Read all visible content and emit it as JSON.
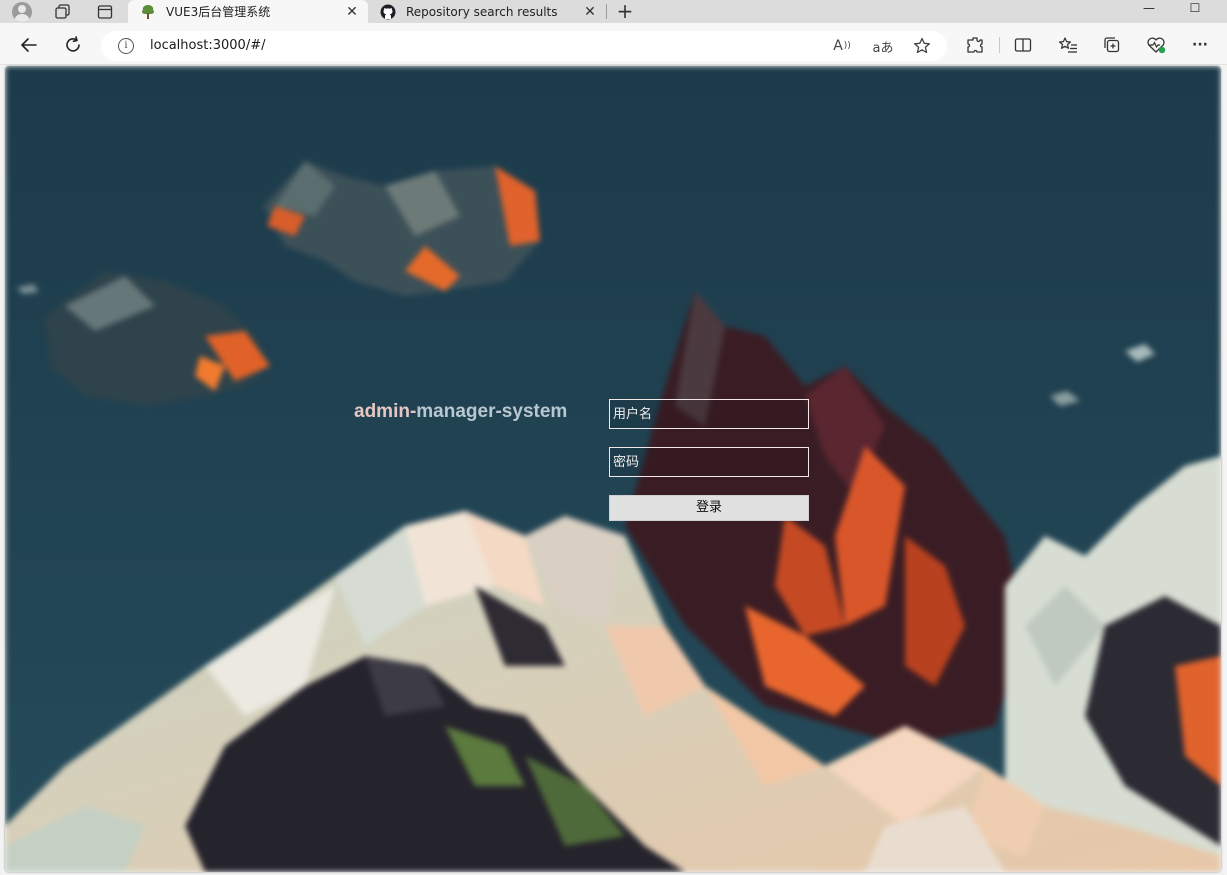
{
  "browser": {
    "tabs": [
      {
        "title": "VUE3后台管理系统",
        "close": "✕",
        "active": true
      },
      {
        "title": "Repository search results",
        "close": "✕",
        "active": false
      }
    ],
    "new_tab_label": "+",
    "window": {
      "minimize": "—",
      "maximize": "☐"
    },
    "address": {
      "url": "localhost:3000/#/",
      "info_glyph": "i"
    },
    "icons": {
      "back": "back-arrow-icon",
      "refresh": "refresh-icon",
      "read_aloud": "read-aloud-icon",
      "translate": "translate-icon",
      "favorite": "star-icon",
      "extensions": "extensions-icon",
      "split_screen": "split-screen-icon",
      "favorites_list": "favorites-list-icon",
      "collections": "collections-icon",
      "performance": "heartbeat-icon",
      "more": "more-icon"
    },
    "omni_labels": {
      "read_aloud": "A",
      "translate": "aあ"
    },
    "more_label": "···"
  },
  "page": {
    "brand": {
      "part1": "admin-",
      "part2": "manager-system"
    },
    "username": {
      "placeholder": "用户名",
      "value": ""
    },
    "password": {
      "placeholder": "密码",
      "value": ""
    },
    "login_label": "登录"
  },
  "colors": {
    "sky": "#1f3d4d",
    "brand_pink": "#e6c7c3",
    "brand_blue": "#b9c7cf",
    "accent_orange": "#e8662e"
  }
}
